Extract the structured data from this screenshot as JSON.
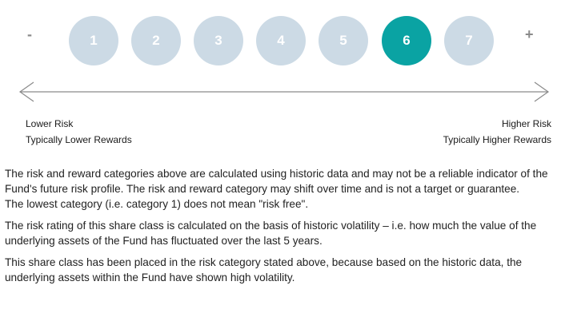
{
  "scale": {
    "minus": "-",
    "plus": "+",
    "categories": [
      "1",
      "2",
      "3",
      "4",
      "5",
      "6",
      "7"
    ],
    "active_category": "6"
  },
  "labels": {
    "left_line1": "Lower Risk",
    "left_line2": "Typically Lower Rewards",
    "right_line1": "Higher Risk",
    "right_line2": "Typically Higher Rewards"
  },
  "paragraphs": [
    "The risk and reward categories above are calculated using historic data and may not be a reliable indicator of the Fund's future risk profile. The risk and reward category may shift over time and is not a target or guarantee.",
    "The lowest category (i.e. category 1) does not mean \"risk free\".",
    "The risk rating of this share class is calculated on the basis of historic volatility – i.e. how much the value of the underlying assets of the Fund has fluctuated over the last 5 years.",
    "This share class has been placed in the risk category stated above, because based on the historic data, the underlying assets within the Fund have shown high volatility."
  ],
  "colors": {
    "inactive": "#ccdae5",
    "active": "#0aa3a3",
    "sign": "#8a8a8a"
  }
}
